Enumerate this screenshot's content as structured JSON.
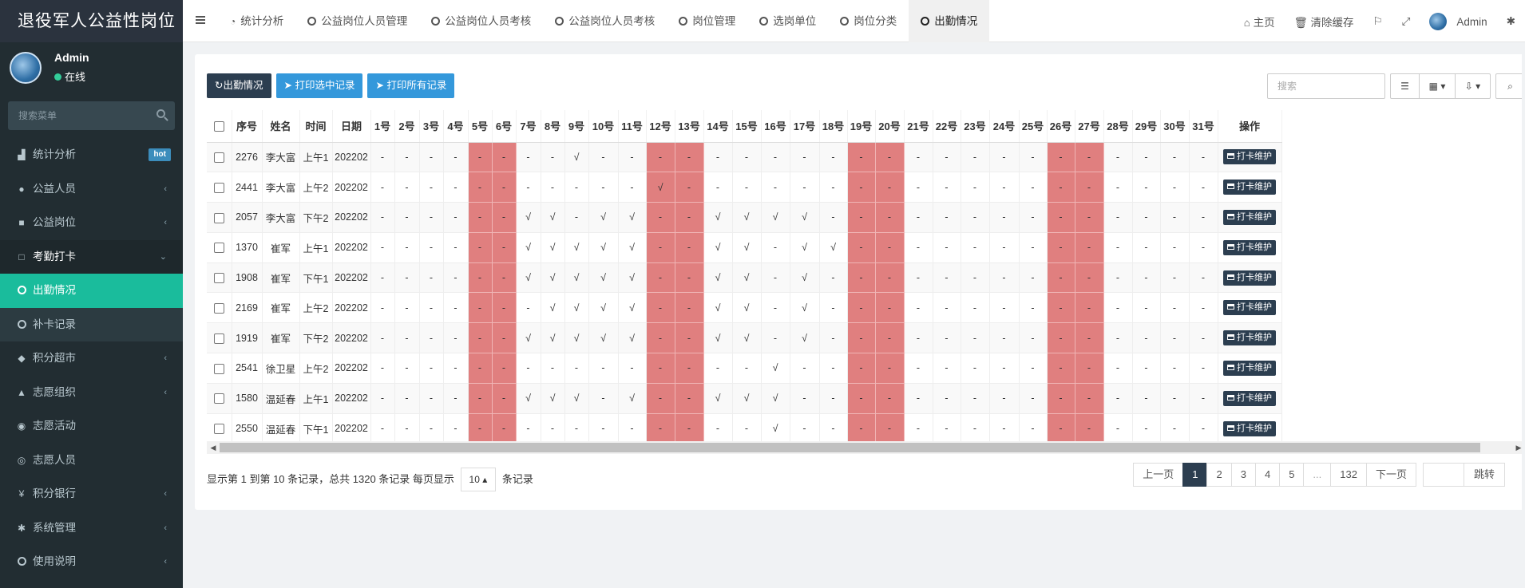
{
  "app": {
    "title": "退役军人公益性岗位"
  },
  "user": {
    "name": "Admin",
    "status": "在线"
  },
  "sidebar": {
    "search_placeholder": "搜索菜单",
    "items": [
      {
        "label": "统计分析",
        "icon": "bar-chart-icon",
        "badge": "hot"
      },
      {
        "label": "公益人员",
        "icon": "user-icon"
      },
      {
        "label": "公益岗位",
        "icon": "briefcase-icon"
      },
      {
        "label": "考勤打卡",
        "icon": "square-icon"
      },
      {
        "label": "出勤情况",
        "icon": "circle-icon"
      },
      {
        "label": "补卡记录",
        "icon": "circle-icon"
      },
      {
        "label": "积分超市",
        "icon": "shield-icon"
      },
      {
        "label": "志愿组织",
        "icon": "binoculars-icon"
      },
      {
        "label": "志愿活动",
        "icon": "eye-icon"
      },
      {
        "label": "志愿人员",
        "icon": "user-circle-icon"
      },
      {
        "label": "积分银行",
        "icon": "yen-icon"
      },
      {
        "label": "系统管理",
        "icon": "gear-icon"
      },
      {
        "label": "使用说明",
        "icon": "circle-icon"
      }
    ]
  },
  "topbar": {
    "tabs": [
      "统计分析",
      "公益岗位人员管理",
      "公益岗位人员考核",
      "公益岗位人员考核",
      "岗位管理",
      "选岗单位",
      "岗位分类",
      "出勤情况"
    ],
    "home": "主页",
    "clear_cache": "清除缓存",
    "user": "Admin"
  },
  "toolbar": {
    "refresh": "出勤情况",
    "print_selected": "打印选中记录",
    "print_all": "打印所有记录",
    "search_placeholder": "搜索"
  },
  "table": {
    "columns": [
      "序号",
      "姓名",
      "时间",
      "日期",
      "1号",
      "2号",
      "3号",
      "4号",
      "5号",
      "6号",
      "7号",
      "8号",
      "9号",
      "10号",
      "11号",
      "12号",
      "13号",
      "14号",
      "15号",
      "16号",
      "17号",
      "18号",
      "19号",
      "20号",
      "21号",
      "22号",
      "23号",
      "24号",
      "25号",
      "26号",
      "27号",
      "28号",
      "29号",
      "30号",
      "31号",
      "操作"
    ],
    "weekend_days": [
      5,
      6,
      12,
      13,
      19,
      20,
      26,
      27
    ],
    "action_label": "打卡维护",
    "rows": [
      {
        "id": "2276",
        "name": "李大富",
        "time": "上午1",
        "date": "202202",
        "days": [
          "-",
          "-",
          "-",
          "-",
          "-",
          "-",
          "-",
          "-",
          "√",
          "-",
          "-",
          "-",
          "-",
          "-",
          "-",
          "-",
          "-",
          "-",
          "-",
          "-",
          "-",
          "-",
          "-",
          "-",
          "-",
          "-",
          "-",
          "-",
          "-",
          "-",
          "-"
        ]
      },
      {
        "id": "2441",
        "name": "李大富",
        "time": "上午2",
        "date": "202202",
        "days": [
          "-",
          "-",
          "-",
          "-",
          "-",
          "-",
          "-",
          "-",
          "-",
          "-",
          "-",
          "√",
          "-",
          "-",
          "-",
          "-",
          "-",
          "-",
          "-",
          "-",
          "-",
          "-",
          "-",
          "-",
          "-",
          "-",
          "-",
          "-",
          "-",
          "-",
          "-"
        ]
      },
      {
        "id": "2057",
        "name": "李大富",
        "time": "下午2",
        "date": "202202",
        "days": [
          "-",
          "-",
          "-",
          "-",
          "-",
          "-",
          "√",
          "√",
          "-",
          "√",
          "√",
          "-",
          "-",
          "√",
          "√",
          "√",
          "√",
          "-",
          "-",
          "-",
          "-",
          "-",
          "-",
          "-",
          "-",
          "-",
          "-",
          "-",
          "-",
          "-",
          "-"
        ]
      },
      {
        "id": "1370",
        "name": "崔军",
        "time": "上午1",
        "date": "202202",
        "days": [
          "-",
          "-",
          "-",
          "-",
          "-",
          "-",
          "√",
          "√",
          "√",
          "√",
          "√",
          "-",
          "-",
          "√",
          "√",
          "-",
          "√",
          "√",
          "-",
          "-",
          "-",
          "-",
          "-",
          "-",
          "-",
          "-",
          "-",
          "-",
          "-",
          "-",
          "-"
        ]
      },
      {
        "id": "1908",
        "name": "崔军",
        "time": "下午1",
        "date": "202202",
        "days": [
          "-",
          "-",
          "-",
          "-",
          "-",
          "-",
          "√",
          "√",
          "√",
          "√",
          "√",
          "-",
          "-",
          "√",
          "√",
          "-",
          "√",
          "-",
          "-",
          "-",
          "-",
          "-",
          "-",
          "-",
          "-",
          "-",
          "-",
          "-",
          "-",
          "-",
          "-"
        ]
      },
      {
        "id": "2169",
        "name": "崔军",
        "time": "上午2",
        "date": "202202",
        "days": [
          "-",
          "-",
          "-",
          "-",
          "-",
          "-",
          "-",
          "√",
          "√",
          "√",
          "√",
          "-",
          "-",
          "√",
          "√",
          "-",
          "√",
          "-",
          "-",
          "-",
          "-",
          "-",
          "-",
          "-",
          "-",
          "-",
          "-",
          "-",
          "-",
          "-",
          "-"
        ]
      },
      {
        "id": "1919",
        "name": "崔军",
        "time": "下午2",
        "date": "202202",
        "days": [
          "-",
          "-",
          "-",
          "-",
          "-",
          "-",
          "√",
          "√",
          "√",
          "√",
          "√",
          "-",
          "-",
          "√",
          "√",
          "-",
          "√",
          "-",
          "-",
          "-",
          "-",
          "-",
          "-",
          "-",
          "-",
          "-",
          "-",
          "-",
          "-",
          "-",
          "-"
        ]
      },
      {
        "id": "2541",
        "name": "徐卫星",
        "time": "上午2",
        "date": "202202",
        "days": [
          "-",
          "-",
          "-",
          "-",
          "-",
          "-",
          "-",
          "-",
          "-",
          "-",
          "-",
          "-",
          "-",
          "-",
          "-",
          "√",
          "-",
          "-",
          "-",
          "-",
          "-",
          "-",
          "-",
          "-",
          "-",
          "-",
          "-",
          "-",
          "-",
          "-",
          "-"
        ]
      },
      {
        "id": "1580",
        "name": "温延春",
        "time": "上午1",
        "date": "202202",
        "days": [
          "-",
          "-",
          "-",
          "-",
          "-",
          "-",
          "√",
          "√",
          "√",
          "-",
          "√",
          "-",
          "-",
          "√",
          "√",
          "√",
          "-",
          "-",
          "-",
          "-",
          "-",
          "-",
          "-",
          "-",
          "-",
          "-",
          "-",
          "-",
          "-",
          "-",
          "-"
        ]
      },
      {
        "id": "2550",
        "name": "温延春",
        "time": "下午1",
        "date": "202202",
        "days": [
          "-",
          "-",
          "-",
          "-",
          "-",
          "-",
          "-",
          "-",
          "-",
          "-",
          "-",
          "-",
          "-",
          "-",
          "-",
          "√",
          "-",
          "-",
          "-",
          "-",
          "-",
          "-",
          "-",
          "-",
          "-",
          "-",
          "-",
          "-",
          "-",
          "-",
          "-"
        ]
      }
    ]
  },
  "footer": {
    "info_prefix": "显示第 1 到第 10 条记录，总共 1320 条记录 每页显示",
    "page_size": "10",
    "info_suffix": "条记录",
    "prev": "上一页",
    "pages": [
      "1",
      "2",
      "3",
      "4",
      "5",
      "...",
      "132"
    ],
    "next": "下一页",
    "jump": "跳转"
  },
  "colors": {
    "accent": "#1abc9c",
    "dark": "#2c3e50",
    "blue": "#3498db",
    "weekend": "#e07f7f",
    "sidebar": "#222d32"
  }
}
